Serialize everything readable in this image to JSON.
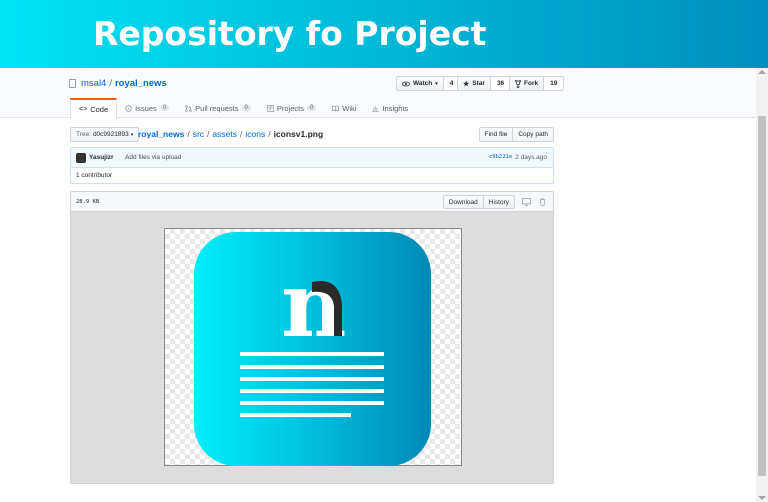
{
  "banner": {
    "title": "Repository fo Project"
  },
  "repo": {
    "owner": "msal4",
    "separator": "/",
    "name": "royal_news"
  },
  "actions": {
    "watch": {
      "label": "Watch",
      "count": "4"
    },
    "star": {
      "label": "Star",
      "count": "36"
    },
    "fork": {
      "label": "Fork",
      "count": "19"
    }
  },
  "tabs": [
    {
      "label": "Code",
      "badge": ""
    },
    {
      "label": "Issues",
      "badge": "0"
    },
    {
      "label": "Pull requests",
      "badge": "0"
    },
    {
      "label": "Projects",
      "badge": "0"
    },
    {
      "label": "Wiki",
      "badge": ""
    },
    {
      "label": "Insights",
      "badge": ""
    }
  ],
  "tree": {
    "prefix": "Tree:",
    "value": "d0c9921893"
  },
  "breadcrumb": [
    "royal_news",
    "src",
    "assets",
    "icons"
  ],
  "breadcrumb_sep": "/",
  "file": {
    "name": "iconsv1.png",
    "size": "28.9 KB"
  },
  "file_buttons": {
    "find": "Find file",
    "copy": "Copy path",
    "download": "Download",
    "history": "History"
  },
  "commit": {
    "author": "Yasujizr",
    "message": "Add files via upload",
    "sha": "c9b221e",
    "time": "2 days ago"
  },
  "contributors": "1 contributor",
  "icon_letter": "n",
  "colors": {
    "banner_start": "#00e5f5",
    "banner_end": "#0090bd",
    "link": "#0366d6",
    "active_tab": "#e36209"
  }
}
